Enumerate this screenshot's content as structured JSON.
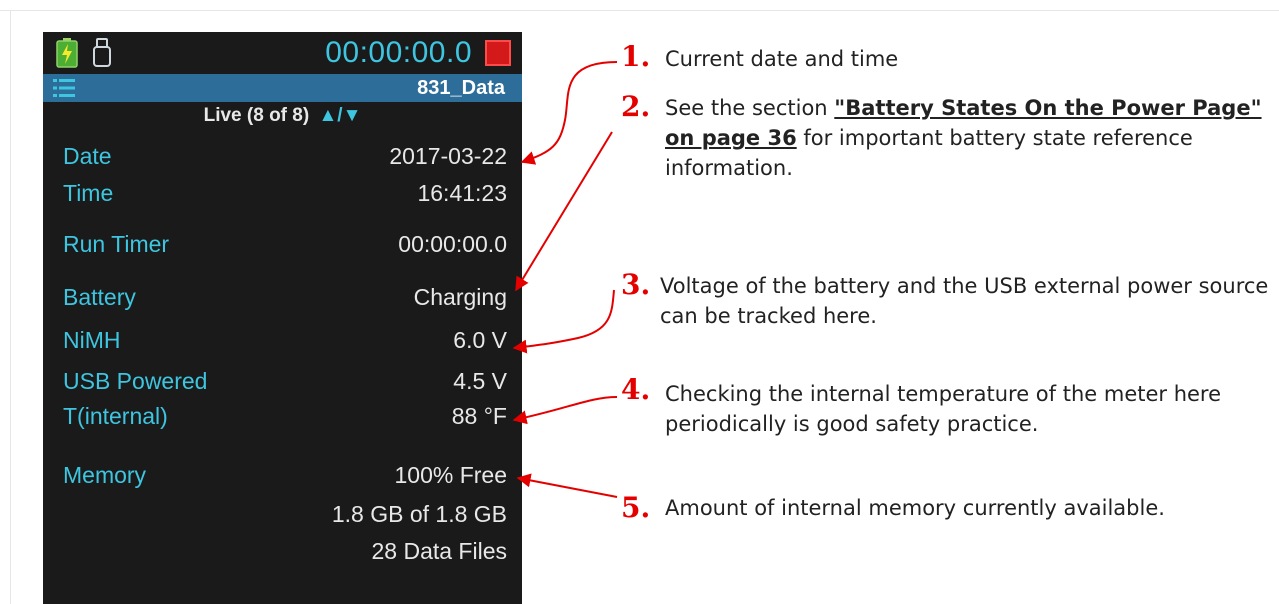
{
  "status_bar": {
    "timer": "00:00:00.0",
    "battery_icon": "battery-charging-icon",
    "usb_icon": "usb-icon",
    "stop_icon": "stop-square-icon"
  },
  "title_bar": {
    "menu_icon": "menu-list-icon",
    "file_name": "831_Data"
  },
  "page": {
    "live_label": "Live (8 of 8)",
    "nav_up": "▲",
    "nav_sep": "/",
    "nav_down": "▼"
  },
  "rows": [
    {
      "label": "Date",
      "value": "2017-03-22"
    },
    {
      "label": "Time",
      "value": "16:41:23"
    },
    {
      "label": "Run Timer",
      "value": "00:00:00.0"
    },
    {
      "label": "Battery",
      "value": "Charging"
    },
    {
      "label": "NiMH",
      "value": "6.0 V"
    },
    {
      "label": "USB Powered",
      "value": "4.5 V"
    },
    {
      "label": "T(internal)",
      "value": "88 °F"
    },
    {
      "label": "Memory",
      "value": "100% Free"
    },
    {
      "label": "",
      "value": "1.8 GB of 1.8 GB"
    },
    {
      "label": "",
      "value": "28 Data Files"
    }
  ],
  "annotations": [
    {
      "num": "1.",
      "text": "Current date and time"
    },
    {
      "num": "2.",
      "pre": "See the section ",
      "link": "\"Battery States On the Power Page\" on page 36",
      "post": " for important battery state reference information."
    },
    {
      "num": "3.",
      "text": "Voltage of the battery and the USB external power source can be tracked here."
    },
    {
      "num": "4.",
      "text": "Checking the internal temperature of the meter here periodically is good safety practice."
    },
    {
      "num": "5.",
      "text": "Amount of internal memory currently available."
    }
  ],
  "colors": {
    "screen_bg": "#1a1a1a",
    "accent_cyan": "#3ec5e0",
    "title_bar": "#2d6d9a",
    "stop_red": "#d31919",
    "annotation_red": "#e50000"
  }
}
